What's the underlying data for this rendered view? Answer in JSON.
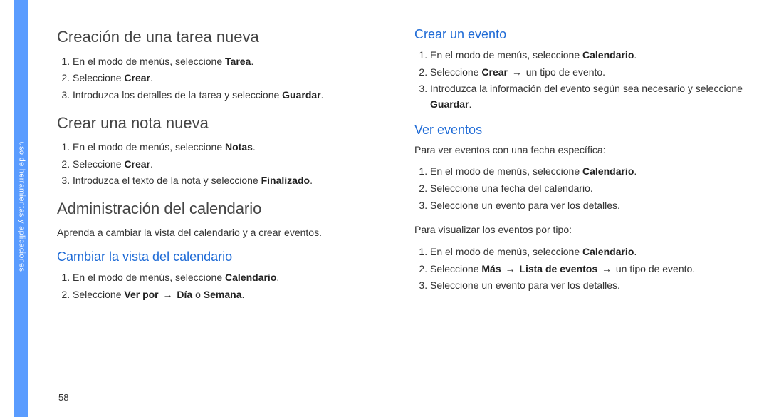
{
  "sidebar": {
    "label": "uso de herramientas y aplicaciones"
  },
  "pageNumber": "58",
  "left": {
    "h1": "Creación de una tarea nueva",
    "list1": [
      {
        "pre": "En el modo de menús, seleccione ",
        "bold": "Tarea",
        "post": "."
      },
      {
        "pre": "Seleccione ",
        "bold": "Crear",
        "post": "."
      },
      {
        "pre": "Introduzca los detalles de la tarea y seleccione ",
        "bold": "Guardar",
        "post": "."
      }
    ],
    "h2": "Crear una nota nueva",
    "list2": [
      {
        "pre": "En el modo de menús, seleccione ",
        "bold": "Notas",
        "post": "."
      },
      {
        "pre": "Seleccione ",
        "bold": "Crear",
        "post": "."
      },
      {
        "pre": "Introduzca el texto de la nota y seleccione ",
        "bold": "Finalizado",
        "post": "."
      }
    ],
    "h3": "Administración del calendario",
    "intro": "Aprenda a cambiar la vista del calendario y a crear eventos.",
    "sub1": "Cambiar la vista del calendario",
    "list3_item1": {
      "pre": "En el modo de menús, seleccione ",
      "bold": "Calendario",
      "post": "."
    },
    "list3_item2": {
      "t1": "Seleccione ",
      "b1": "Ver por",
      "arrow": "→",
      "b2": "Día",
      "t2": " o ",
      "b3": "Semana",
      "t3": "."
    }
  },
  "right": {
    "sub1": "Crear un evento",
    "list1_item1": {
      "pre": "En el modo de menús, seleccione ",
      "bold": "Calendario",
      "post": "."
    },
    "list1_item2": {
      "t1": "Seleccione ",
      "b1": "Crear",
      "arrow": "→",
      "t2": " un tipo de evento."
    },
    "list1_item3": {
      "pre": "Introduzca la información del evento según sea necesario y seleccione ",
      "bold": "Guardar",
      "post": "."
    },
    "sub2": "Ver eventos",
    "intro1": "Para ver eventos con una fecha específica:",
    "list2": [
      {
        "pre": "En el modo de menús, seleccione ",
        "bold": "Calendario",
        "post": "."
      },
      {
        "pre": "Seleccione una fecha del calendario.",
        "bold": "",
        "post": ""
      },
      {
        "pre": "Seleccione un evento para ver los detalles.",
        "bold": "",
        "post": ""
      }
    ],
    "intro2": "Para visualizar los eventos por tipo:",
    "list3_item1": {
      "pre": "En el modo de menús, seleccione ",
      "bold": "Calendario",
      "post": "."
    },
    "list3_item2": {
      "t1": "Seleccione ",
      "b1": "Más",
      "arrow1": "→",
      "b2": "Lista de eventos",
      "arrow2": "→",
      "t2": " un tipo de evento."
    },
    "list3_item3": {
      "pre": "Seleccione un evento para ver los detalles.",
      "bold": "",
      "post": ""
    }
  }
}
